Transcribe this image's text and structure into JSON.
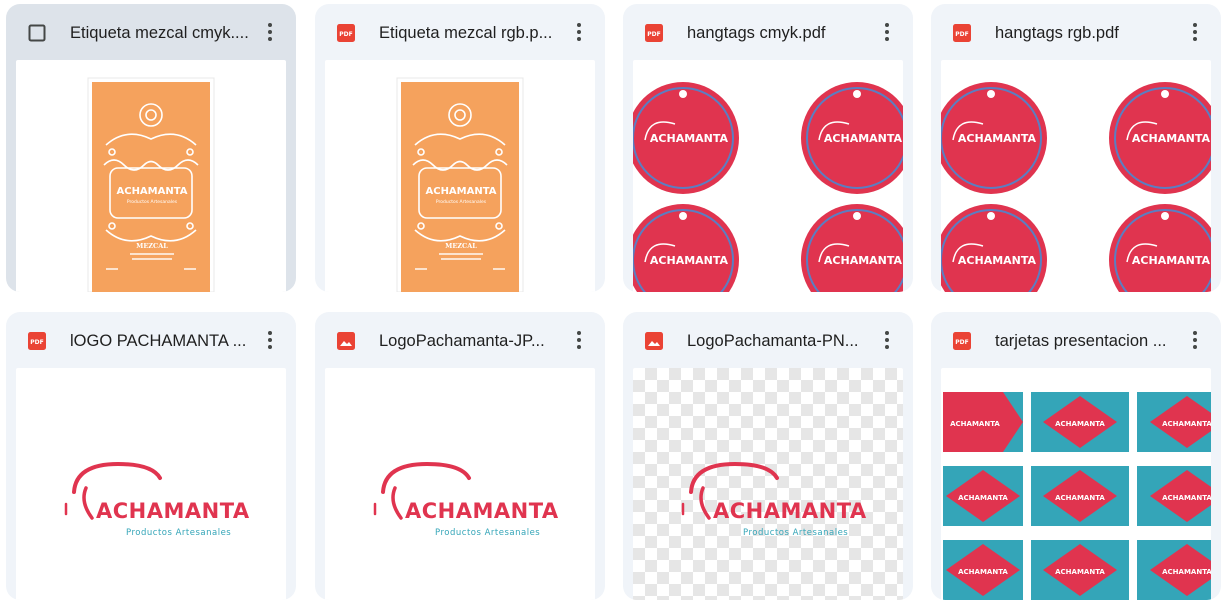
{
  "files": [
    {
      "title": "Etiqueta mezcal cmyk....",
      "icon": "checkbox-icon",
      "thumbnail": "orange-label"
    },
    {
      "title": "Etiqueta mezcal rgb.p...",
      "icon": "pdf-icon",
      "thumbnail": "orange-label"
    },
    {
      "title": "hangtags cmyk.pdf",
      "icon": "pdf-icon",
      "thumbnail": "hangtags"
    },
    {
      "title": "hangtags rgb.pdf",
      "icon": "pdf-icon",
      "thumbnail": "hangtags"
    },
    {
      "title": "lOGO PACHAMANTA ...",
      "icon": "pdf-icon",
      "thumbnail": "logo"
    },
    {
      "title": "LogoPachamanta-JP...",
      "icon": "image-icon",
      "thumbnail": "logo"
    },
    {
      "title": "LogoPachamanta-PN...",
      "icon": "image-icon",
      "thumbnail": "logo-transparent"
    },
    {
      "title": "tarjetas presentacion ...",
      "icon": "pdf-icon",
      "thumbnail": "business-cards"
    }
  ],
  "logo": {
    "wordmark": "ACHAMANTA",
    "tagline": "Productos Artesanales"
  },
  "label_text": {
    "name": "MEZCAL"
  },
  "colors": {
    "pdf_red": "#ea4335",
    "brand_pink": "#e0344f",
    "brand_teal": "#34a5b8",
    "label_orange": "#f5a25d"
  }
}
